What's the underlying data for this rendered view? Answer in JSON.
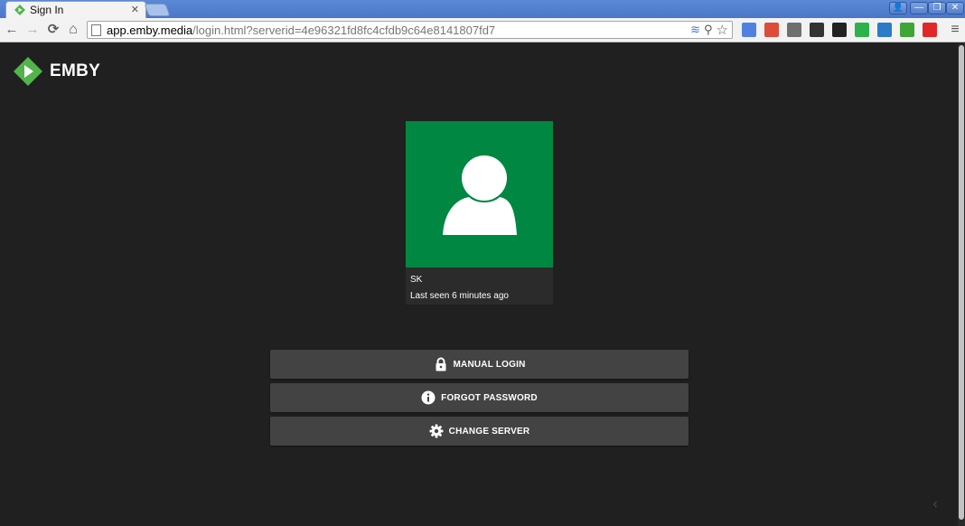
{
  "browser": {
    "tab": {
      "title": "Sign In",
      "close": "✕"
    },
    "window_controls": [
      "👤",
      "—",
      "❐",
      "✕"
    ],
    "nav": {
      "back": "←",
      "forward": "→",
      "reload": "⟳",
      "home": "⌂"
    },
    "url": {
      "host": "app.emby.media",
      "rest": "/login.html?serverid=4e96321fd8fc4cfdb9c64e8141807fd7"
    },
    "omnibox_icons": [
      "≋",
      "⚲",
      "☆"
    ],
    "menu": "≡",
    "extensions": [
      {
        "name": "translate-icon",
        "color": "#4f82e0"
      },
      {
        "name": "chrome-apps-icon",
        "color": "#dd4b39"
      },
      {
        "name": "keyboard-icon",
        "color": "#6f6f6f"
      },
      {
        "name": "feather-icon",
        "color": "#333333"
      },
      {
        "name": "buffer-icon",
        "color": "#222222"
      },
      {
        "name": "feedly-icon",
        "color": "#2bb24c"
      },
      {
        "name": "s-icon",
        "color": "#2b7bc7"
      },
      {
        "name": "download-icon",
        "color": "#3fa535"
      },
      {
        "name": "flipboard-icon",
        "color": "#e12828"
      }
    ]
  },
  "app": {
    "logo_text": "EMBY",
    "brand_color": "#52b54b",
    "user": {
      "name": "SK",
      "last_seen": "Last seen 6 minutes ago",
      "avatar_color": "#008741"
    },
    "buttons": [
      {
        "label": "MANUAL LOGIN",
        "icon": "lock-icon"
      },
      {
        "label": "FORGOT PASSWORD",
        "icon": "info-icon"
      },
      {
        "label": "CHANGE SERVER",
        "icon": "gear-icon"
      }
    ]
  }
}
